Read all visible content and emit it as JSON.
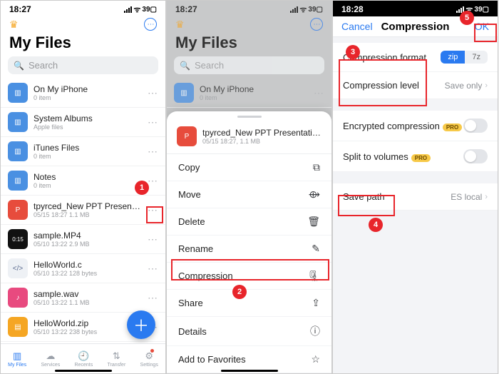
{
  "status": {
    "time1": "18:27",
    "time2": "18:27",
    "time3": "18:28",
    "battery": "39"
  },
  "screen1": {
    "title": "My Files",
    "search_placeholder": "Search",
    "folders": [
      {
        "name": "On My iPhone",
        "sub": "0 item"
      },
      {
        "name": "System Albums",
        "sub": "Apple files"
      },
      {
        "name": "iTunes Files",
        "sub": "0 item"
      },
      {
        "name": "Notes",
        "sub": "0 item"
      }
    ],
    "files": [
      {
        "name": "tpyrced_New PPT Presentation.ppt",
        "sub": "05/15 18:27   1.1 MB",
        "kind": "ppt"
      },
      {
        "name": "sample.MP4",
        "sub": "05/10 13:22   2.9 MB",
        "kind": "video",
        "thumb": "0:15"
      },
      {
        "name": "HelloWorld.c",
        "sub": "05/10 13:22   128 bytes",
        "kind": "code"
      },
      {
        "name": "sample.wav",
        "sub": "05/10 13:22   1.1 MB",
        "kind": "audio"
      },
      {
        "name": "HelloWorld.zip",
        "sub": "05/10 13:22   238 bytes",
        "kind": "zip"
      }
    ],
    "tabs": [
      "My Files",
      "Services",
      "Recents",
      "Transfer",
      "Settings"
    ]
  },
  "screen2": {
    "title": "My Files",
    "search_placeholder": "Search",
    "folder": {
      "name": "On My iPhone",
      "sub": "0 item"
    },
    "file": {
      "name": "tpyrced_New PPT Presentation.ppt",
      "sub": "05/15 18:27, 1.1 MB"
    },
    "actions": [
      "Copy",
      "Move",
      "Delete",
      "Rename",
      "Compression",
      "Share",
      "Details",
      "Add to Favorites"
    ]
  },
  "screen3": {
    "cancel": "Cancel",
    "title": "Compression",
    "ok": "OK",
    "opts": {
      "format_label": "Compression format",
      "format_values": [
        "zip",
        "7z"
      ],
      "level_label": "Compression level",
      "level_value": "Save only",
      "encrypted_label": "Encrypted compression",
      "split_label": "Split to volumes",
      "pro": "PRO",
      "savepath_label": "Save path",
      "savepath_value": "ES local"
    }
  },
  "callouts": {
    "c1": "1",
    "c2": "2",
    "c3": "3",
    "c4": "4",
    "c5": "5"
  }
}
